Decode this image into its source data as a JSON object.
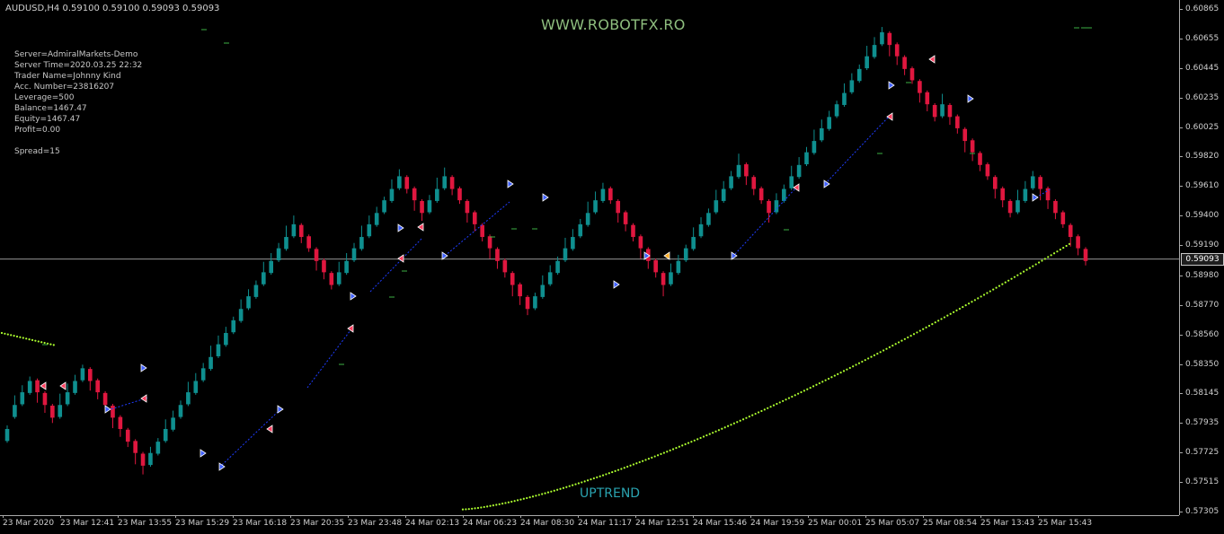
{
  "header": {
    "symbol_line": "AUDUSD,H4  0.59100 0.59100 0.59093 0.59093"
  },
  "watermark": "WWW.ROBOTFX.RO",
  "trend_label": "UPTREND",
  "account_info": {
    "server": "Server=AdmiralMarkets-Demo",
    "server_time": "Server Time=2020.03.25 22:32",
    "trader_name": "Trader Name=Johnny Kind",
    "acc_number": "Acc. Number=23816207",
    "leverage": "Leverage=500",
    "balance": "Balance=1467.47",
    "equity": "Equity=1467.47",
    "profit": "Profit=0.00",
    "spread": "Spread=15"
  },
  "price_axis": {
    "ticks": [
      "0.60865",
      "0.60655",
      "0.60445",
      "0.60235",
      "0.60025",
      "0.59820",
      "0.59610",
      "0.59400",
      "0.59190",
      "0.58980",
      "0.58770",
      "0.58560",
      "0.58350",
      "0.58145",
      "0.57935",
      "0.57725",
      "0.57515",
      "0.57305"
    ],
    "current_price": "0.59093"
  },
  "time_axis": {
    "ticks": [
      "23 Mar 2020",
      "23 Mar 12:41",
      "23 Mar 13:55",
      "23 Mar 15:29",
      "23 Mar 16:18",
      "23 Mar 20:35",
      "23 Mar 23:48",
      "24 Mar 02:13",
      "24 Mar 06:23",
      "24 Mar 08:30",
      "24 Mar 11:17",
      "24 Mar 12:51",
      "24 Mar 15:46",
      "24 Mar 19:59",
      "25 Mar 00:01",
      "25 Mar 05:07",
      "25 Mar 08:54",
      "25 Mar 13:43",
      "25 Mar 15:43"
    ]
  },
  "colors": {
    "bull": "#0f8f8f",
    "bear": "#e0173f",
    "dots": "#adff2f",
    "grid_line": "#c8c8c8",
    "trend_line": "#1e3cff"
  },
  "chart_data": {
    "type": "candlestick",
    "symbol": "AUDUSD",
    "timeframe": "H4",
    "ylim": [
      0.57305,
      0.60865
    ],
    "current_price": 0.59093,
    "renko_box": 0.00085,
    "closes": [
      0.5789,
      0.5806,
      0.5815,
      0.5823,
      0.5815,
      0.5806,
      0.5797,
      0.5806,
      0.5815,
      0.5823,
      0.5832,
      0.5823,
      0.5815,
      0.5806,
      0.5797,
      0.5789,
      0.578,
      0.5772,
      0.5763,
      0.5772,
      0.578,
      0.5789,
      0.5797,
      0.5806,
      0.5815,
      0.5823,
      0.5832,
      0.584,
      0.5849,
      0.5857,
      0.5866,
      0.5874,
      0.5883,
      0.5891,
      0.59,
      0.5908,
      0.5917,
      0.5925,
      0.5934,
      0.5925,
      0.5917,
      0.5908,
      0.59,
      0.5891,
      0.59,
      0.5908,
      0.5917,
      0.5925,
      0.5934,
      0.5942,
      0.5951,
      0.5959,
      0.5968,
      0.5959,
      0.5951,
      0.5942,
      0.5951,
      0.5959,
      0.5968,
      0.5959,
      0.5951,
      0.5942,
      0.5934,
      0.5925,
      0.5917,
      0.5908,
      0.59,
      0.5891,
      0.5883,
      0.5874,
      0.5883,
      0.5891,
      0.59,
      0.5908,
      0.5917,
      0.5925,
      0.5934,
      0.5942,
      0.5951,
      0.5959,
      0.5951,
      0.5942,
      0.5934,
      0.5925,
      0.5917,
      0.5908,
      0.59,
      0.5891,
      0.59,
      0.5908,
      0.5917,
      0.5925,
      0.5934,
      0.5942,
      0.5951,
      0.5959,
      0.5968,
      0.5976,
      0.5968,
      0.5959,
      0.5951,
      0.5942,
      0.5951,
      0.5959,
      0.5968,
      0.5976,
      0.5985,
      0.5993,
      0.6002,
      0.601,
      0.6019,
      0.6027,
      0.6036,
      0.6044,
      0.6053,
      0.6061,
      0.607,
      0.6061,
      0.6053,
      0.6044,
      0.6036,
      0.6027,
      0.6019,
      0.601,
      0.6019,
      0.601,
      0.6002,
      0.5993,
      0.5985,
      0.5976,
      0.5968,
      0.5959,
      0.5951,
      0.5942,
      0.5951,
      0.5959,
      0.5968,
      0.5959,
      0.5951,
      0.5942,
      0.5934,
      0.5925,
      0.5917,
      0.5908
    ]
  }
}
